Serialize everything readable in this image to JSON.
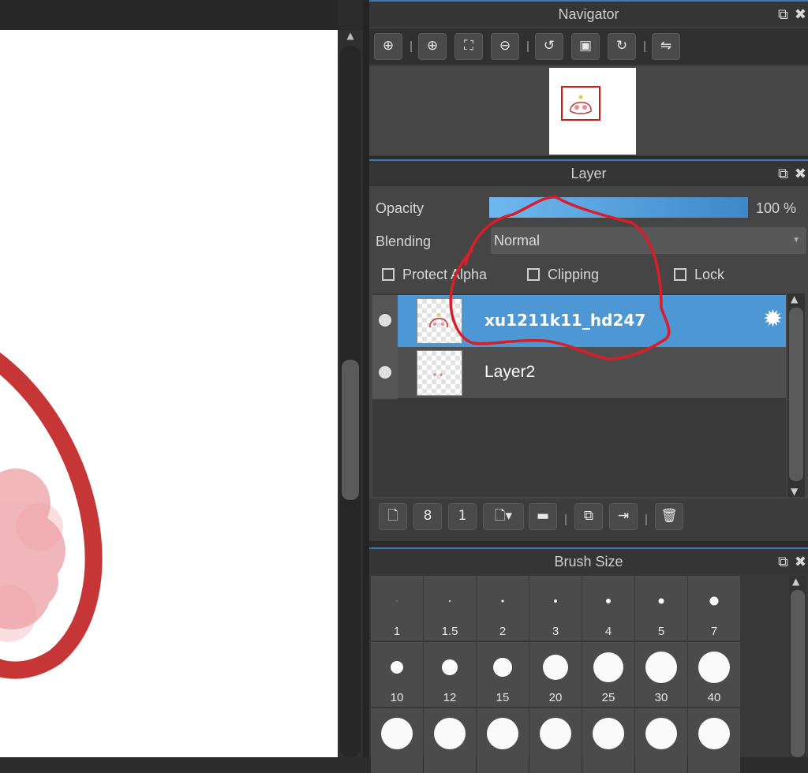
{
  "navigator": {
    "title": "Navigator",
    "tools": [
      "zoom-actual-icon",
      "zoom-in-icon",
      "fit-screen-icon",
      "zoom-out-icon",
      "rotate-left-icon",
      "fit-window-icon",
      "rotate-right-icon",
      "flip-horizontal-icon"
    ]
  },
  "layer": {
    "title": "Layer",
    "opacity_label": "Opacity",
    "opacity_value": "100 %",
    "opacity": 1.0,
    "blending_label": "Blending",
    "blending_value": "Normal",
    "protect_alpha_label": "Protect Alpha",
    "clipping_label": "Clipping",
    "lock_label": "Lock",
    "rows": [
      {
        "name": "xu1211k11_hd247",
        "selected": true
      },
      {
        "name": "Layer2",
        "selected": false
      }
    ],
    "tools": [
      "new-layer-icon",
      "new-8bit-layer-icon",
      "new-1bit-layer-icon",
      "add-layer-dropdown-icon",
      "new-folder-icon",
      "duplicate-layer-icon",
      "merge-down-icon",
      "delete-layer-icon"
    ]
  },
  "brush": {
    "title": "Brush Size",
    "sizes": [
      "1",
      "1.5",
      "2",
      "3",
      "4",
      "5",
      "7",
      "10",
      "12",
      "15",
      "20",
      "25",
      "30",
      "40",
      "",
      "",
      "",
      "",
      "",
      "",
      ""
    ]
  },
  "colors": {
    "accent": "#4c97d4",
    "panel": "#454545",
    "annotation": "#d81e28",
    "stroke": "#c63636"
  }
}
